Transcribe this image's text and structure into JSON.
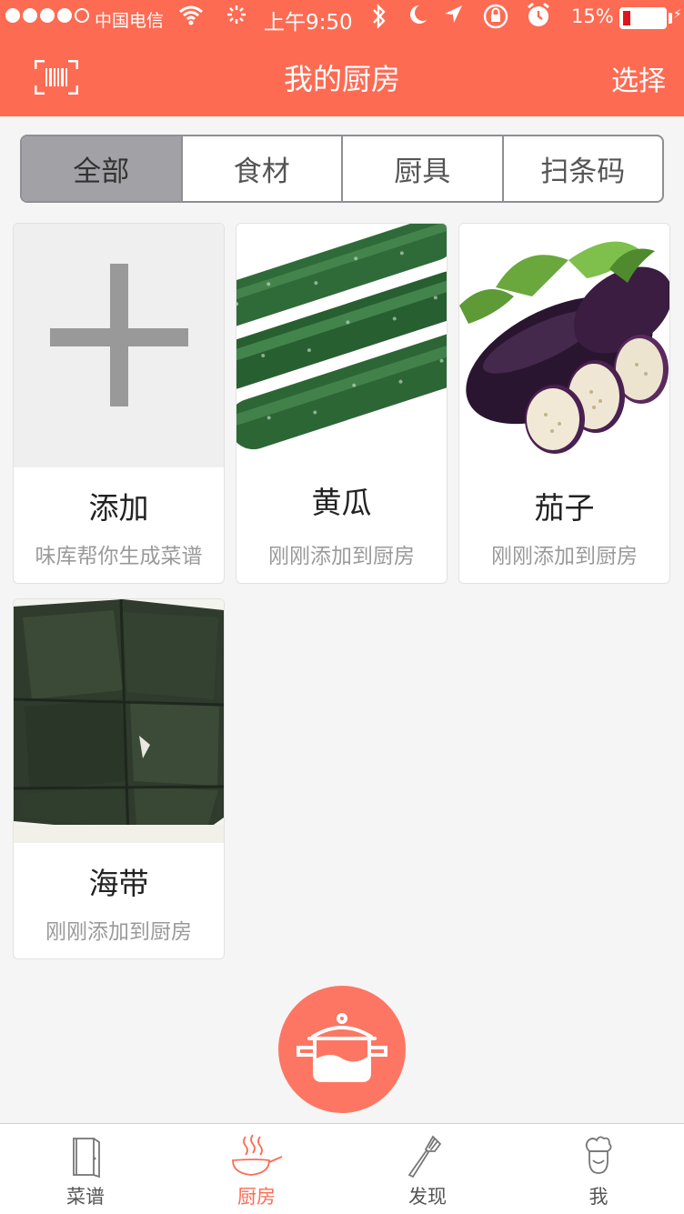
{
  "status_bar": {
    "carrier": "中国电信",
    "time": "上午9:50",
    "battery": "15%",
    "battery_level": 0.15
  },
  "header": {
    "title": "我的厨房",
    "select_label": "选择"
  },
  "segments": [
    {
      "label": "全部",
      "active": true
    },
    {
      "label": "食材",
      "active": false
    },
    {
      "label": "厨具",
      "active": false
    },
    {
      "label": "扫条码",
      "active": false
    }
  ],
  "cards": [
    {
      "name": "添加",
      "desc": "味库帮你生成菜谱",
      "icon": "plus-icon"
    },
    {
      "name": "黄瓜",
      "desc": "刚刚添加到厨房",
      "icon": "cucumber-image"
    },
    {
      "name": "茄子",
      "desc": "刚刚添加到厨房",
      "icon": "eggplant-image"
    },
    {
      "name": "海带",
      "desc": "刚刚添加到厨房",
      "icon": "kelp-image"
    }
  ],
  "tabbar": [
    {
      "label": "菜谱",
      "icon": "recipe-book-icon",
      "active": false
    },
    {
      "label": "厨房",
      "icon": "pan-icon",
      "active": true
    },
    {
      "label": "发现",
      "icon": "fork-icon",
      "active": false
    },
    {
      "label": "我",
      "icon": "chef-icon",
      "active": false
    }
  ],
  "colors": {
    "accent": "#fd6b53",
    "fab": "#fd7663"
  }
}
